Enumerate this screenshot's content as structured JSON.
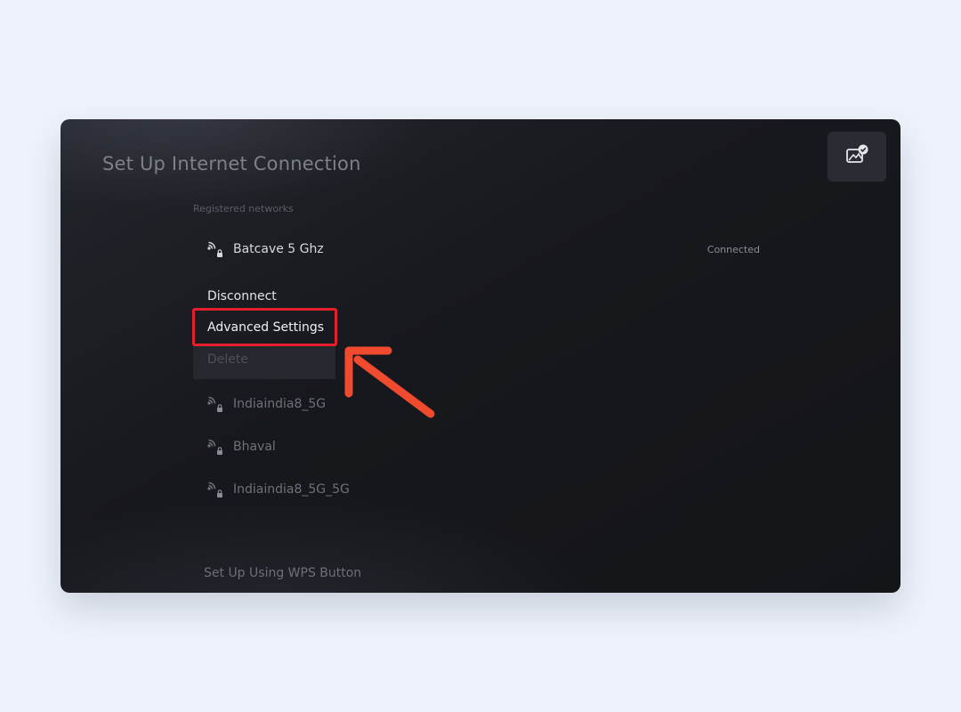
{
  "header": {
    "title": "Set Up Internet Connection",
    "capture_icon": "screenshot-check-icon"
  },
  "registered": {
    "label": "Registered networks",
    "connected_network": {
      "name": "Batcave 5 Ghz",
      "status": "Connected",
      "icon": "wifi-lock-icon"
    },
    "actions": {
      "disconnect": "Disconnect",
      "advanced_settings": "Advanced Settings",
      "delete": "Delete"
    },
    "other_networks": [
      {
        "name": "Indiaindia8_5G",
        "icon": "wifi-lock-icon"
      },
      {
        "name": "Bhaval",
        "icon": "wifi-lock-icon"
      },
      {
        "name": "Indiaindia8_5G_5G",
        "icon": "wifi-lock-icon"
      }
    ]
  },
  "footer": {
    "wps_label": "Set Up Using WPS Button"
  },
  "annotation": {
    "highlight_color": "#e51f2b",
    "arrow_color": "#f04a2f"
  }
}
